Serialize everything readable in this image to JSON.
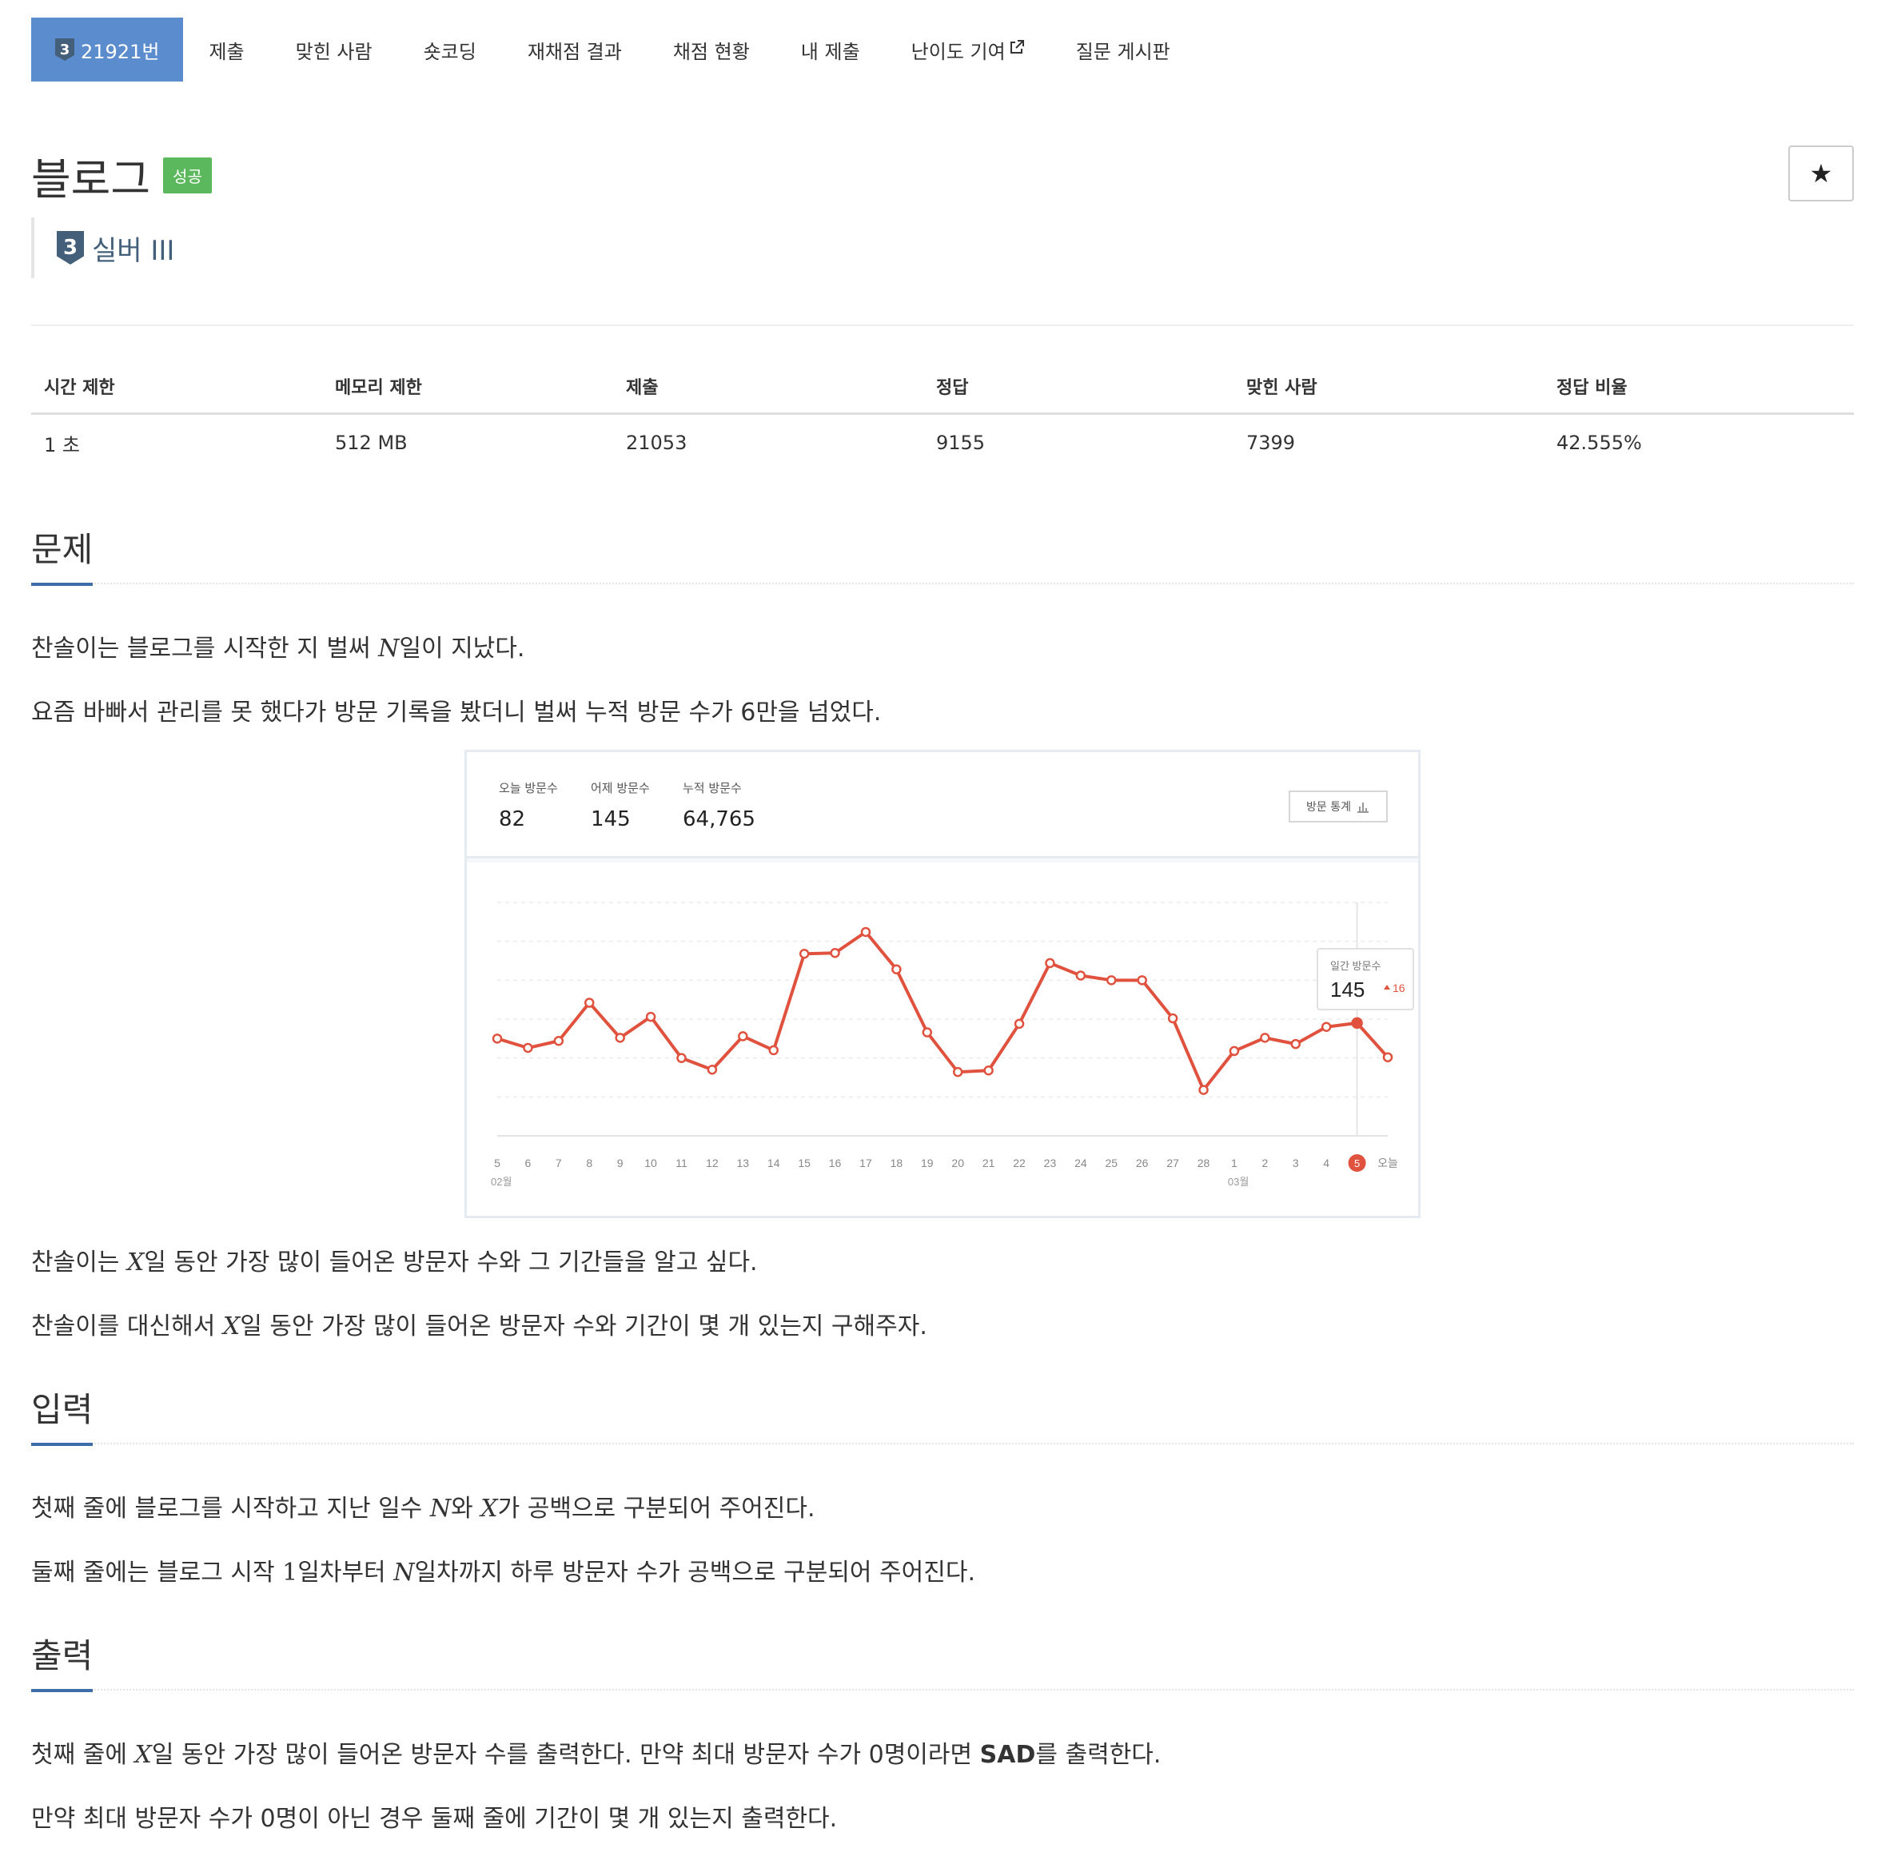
{
  "nav": {
    "problem_tier": "3",
    "problem_number": "21921번",
    "items": [
      "제출",
      "맞힌 사람",
      "숏코딩",
      "재채점 결과",
      "채점 현황",
      "내 제출",
      "난이도 기여",
      "질문 게시판"
    ],
    "external_icon": "external-link-icon"
  },
  "title": {
    "name": "블로그",
    "result_badge": "성공",
    "star": "★",
    "tier_number": "3",
    "tier_name": "실버 III"
  },
  "info_table": {
    "headers": [
      "시간 제한",
      "메모리 제한",
      "제출",
      "정답",
      "맞힌 사람",
      "정답 비율"
    ],
    "values": [
      "1 초",
      "512 MB",
      "21053",
      "9155",
      "7399",
      "42.555%"
    ]
  },
  "sections": {
    "problem": {
      "heading": "문제",
      "p1": [
        "찬솔이는 블로그를 시작한 지 벌써 ",
        "N",
        "일이 지났다."
      ],
      "p2": "요즘 바빠서 관리를 못 했다가 방문 기록을 봤더니 벌써 누적 방문 수가 6만을 넘었다.",
      "p3": [
        "찬솔이는 ",
        "X",
        "일 동안 가장 많이 들어온 방문자 수와 그 기간들을 알고 싶다."
      ],
      "p4": [
        "찬솔이를 대신해서 ",
        "X",
        "일 동안 가장 많이 들어온 방문자 수와 기간이 몇 개 있는지 구해주자."
      ]
    },
    "input": {
      "heading": "입력",
      "p1": [
        "첫째 줄에 블로그를 시작하고 지난 일수 ",
        "N",
        "와 ",
        "X",
        "가 공백으로 구분되어 주어진다."
      ],
      "p2": [
        "둘째 줄에는 블로그 시작 ",
        "1",
        "일차부터 ",
        "N",
        "일차까지 하루 방문자 수가 공백으로 구분되어 주어진다."
      ]
    },
    "output": {
      "heading": "출력",
      "p1": [
        "첫째 줄에 ",
        "X",
        "일 동안 가장 많이 들어온 방문자 수를 출력한다. 만약 최대 방문자 수가 0명이라면 ",
        "SAD",
        "를 출력한다."
      ],
      "p2": "만약 최대 방문자 수가 0명이 아닌 경우 둘째 줄에 기간이 몇 개 있는지 출력한다."
    }
  },
  "figure": {
    "stats": [
      {
        "label": "오늘 방문수",
        "value": "82"
      },
      {
        "label": "어제 방문수",
        "value": "145"
      },
      {
        "label": "누적 방문수",
        "value": "64,765"
      }
    ],
    "stats_button": "방문 통계",
    "chart_data": {
      "type": "line",
      "categories": [
        "5",
        "6",
        "7",
        "8",
        "9",
        "10",
        "11",
        "12",
        "13",
        "14",
        "15",
        "16",
        "17",
        "18",
        "19",
        "20",
        "21",
        "22",
        "23",
        "24",
        "25",
        "26",
        "27",
        "28",
        "1",
        "2",
        "3",
        "4",
        "5",
        "오늘"
      ],
      "month_labels": [
        "02월",
        "03월"
      ],
      "highlight_index": 28,
      "series": [
        {
          "values": [
            125,
            113,
            122,
            171,
            126,
            153,
            100,
            85,
            128,
            110,
            234,
            235,
            262,
            214,
            133,
            82,
            84,
            144,
            222,
            206,
            200,
            200,
            151,
            59,
            109,
            126,
            118,
            140,
            145,
            101
          ],
          "color": "#e0523e"
        }
      ],
      "tooltip": {
        "label": "일간 방문수",
        "value": "145",
        "delta": "16",
        "delta_icon": "triangle-up-icon"
      },
      "grid": true
    }
  }
}
